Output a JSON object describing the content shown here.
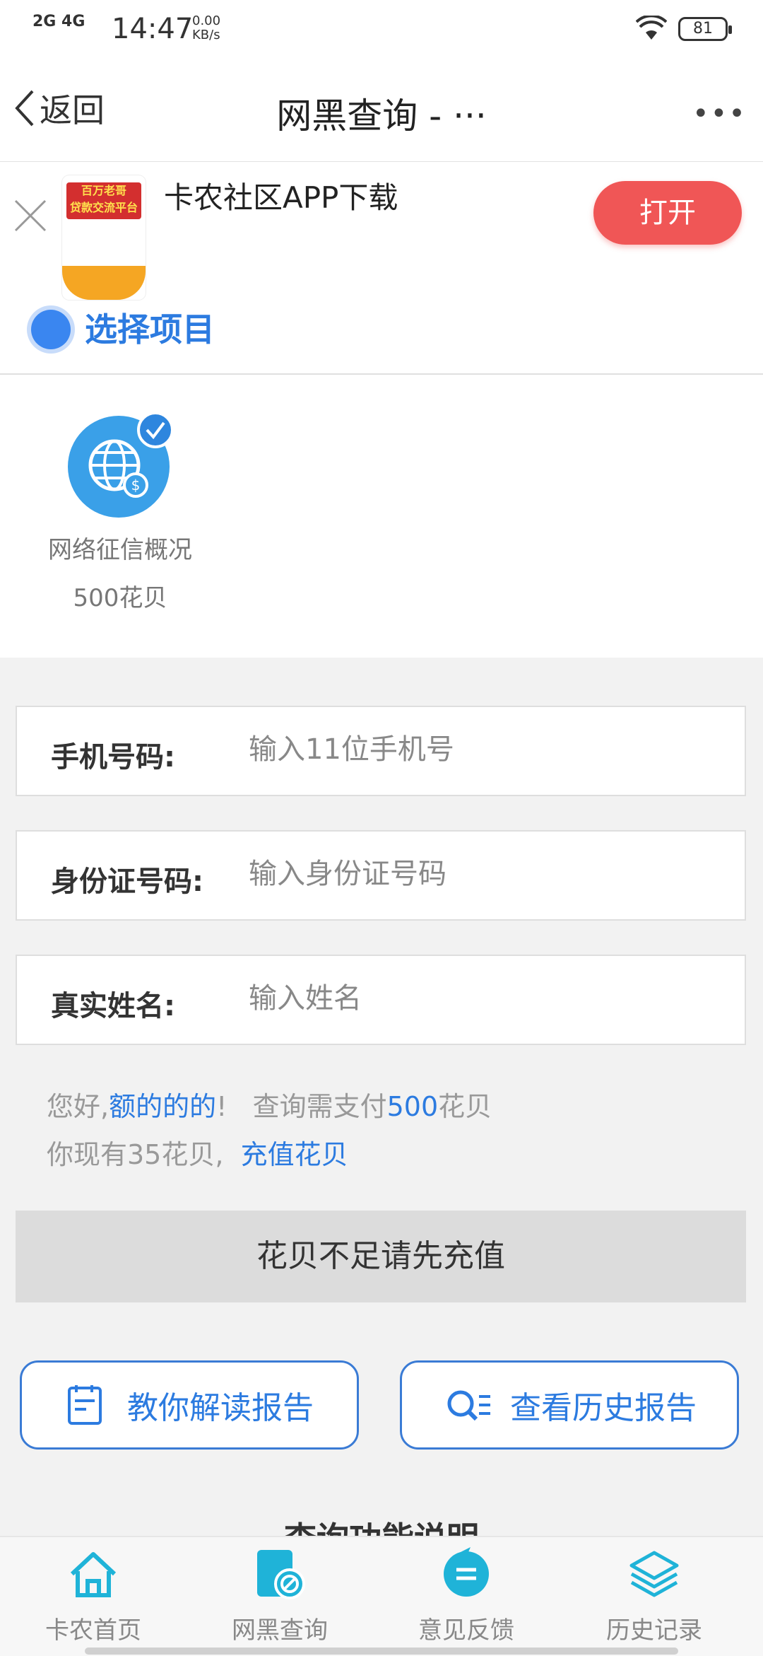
{
  "status_bar": {
    "network": "2G 4G",
    "time": "14:47",
    "speed": "0.00\nKB/s",
    "battery": "81"
  },
  "nav": {
    "back_label": "返回",
    "title": "网黑查询 - ···",
    "more": "•••"
  },
  "ad": {
    "title": "卡农社区APP下载",
    "button": "打开",
    "thumb_text": "百万老哥\n贷款交流平台"
  },
  "select": {
    "label": "选择项目"
  },
  "project": {
    "name": "网络征信概况",
    "price": "500花贝"
  },
  "form": {
    "phone_label": "手机号码:",
    "phone_placeholder": "输入11位手机号",
    "id_label": "身份证号码:",
    "id_placeholder": "输入身份证号码",
    "name_label": "真实姓名:",
    "name_placeholder": "输入姓名"
  },
  "info": {
    "greeting": "您好,",
    "username": "额的的的",
    "exclaim": "!",
    "pay_text": "查询需支付",
    "pay_amount": "500",
    "pay_unit": "花贝",
    "balance_text": "你现有35花贝,",
    "recharge_link": "充值花贝"
  },
  "submit_button": "花贝不足请先充值",
  "actions": {
    "read_report": "教你解读报告",
    "history_report": "查看历史报告"
  },
  "section_title": "查询功能说明",
  "tabs": [
    {
      "label": "卡农首页",
      "icon": "home-icon"
    },
    {
      "label": "网黑查询",
      "icon": "query-icon"
    },
    {
      "label": "意见反馈",
      "icon": "feedback-icon"
    },
    {
      "label": "历史记录",
      "icon": "layers-icon"
    }
  ],
  "colors": {
    "accent": "#2c7be0",
    "open_button": "#f05656",
    "tab_icon": "#1fb3d8"
  }
}
